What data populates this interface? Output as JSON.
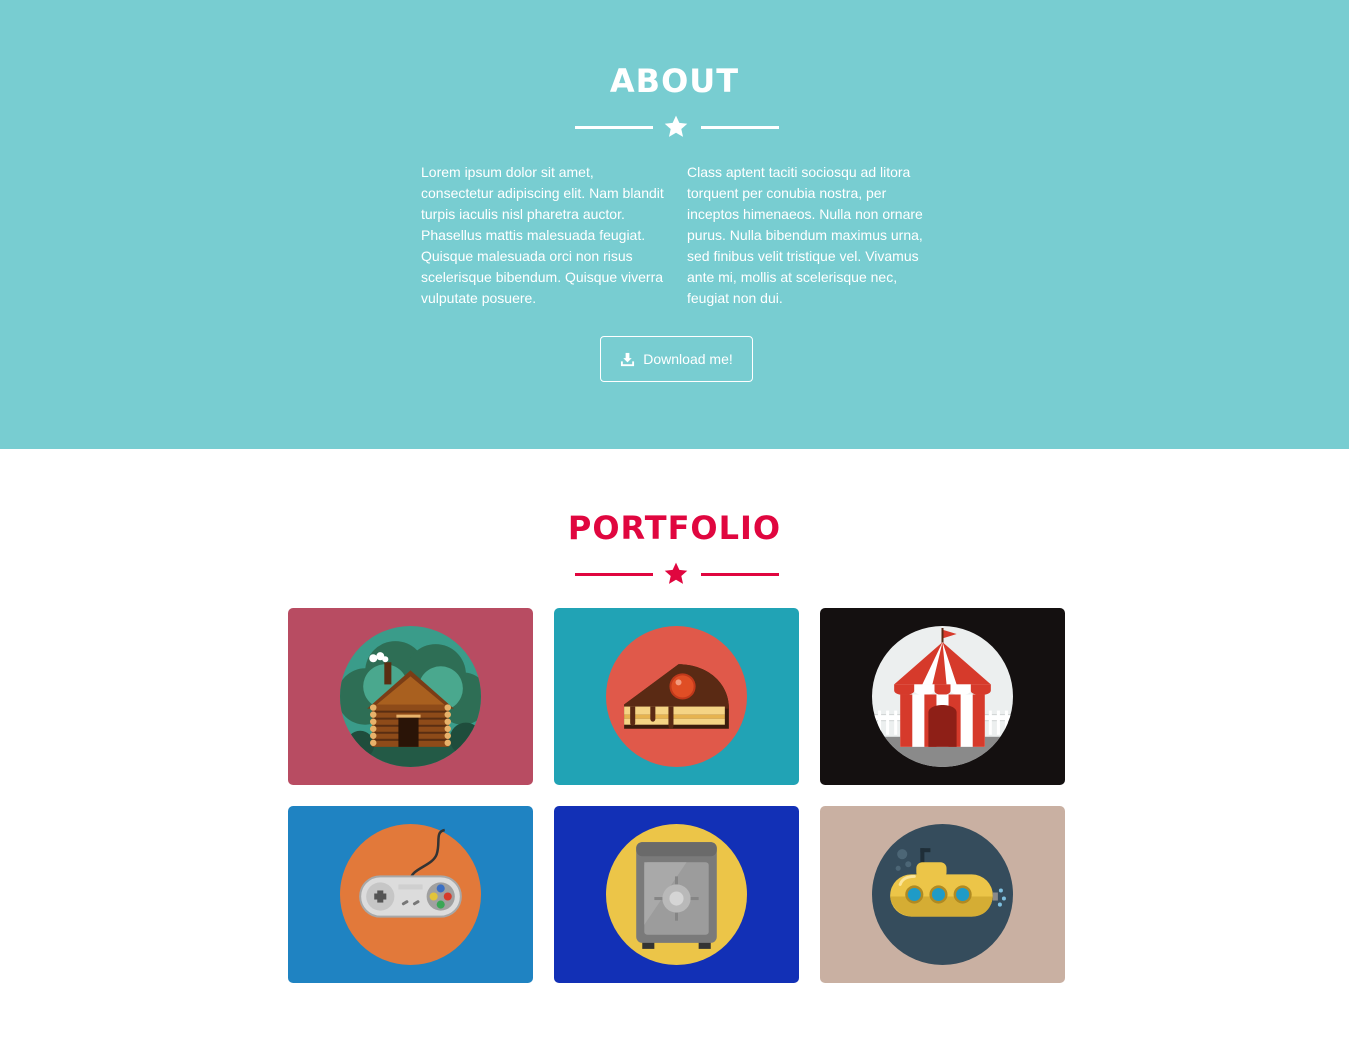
{
  "about": {
    "title": "ABOUT",
    "text_left": "Lorem ipsum dolor sit amet, consectetur adipiscing elit. Nam blandit turpis iaculis nisl pharetra auctor. Phasellus mattis malesuada feugiat. Quisque malesuada orci non risus scelerisque bibendum. Quisque viverra vulputate posuere.",
    "text_right": "Class aptent taciti sociosqu ad litora torquent per conubia nostra, per inceptos himenaeos. Nulla non ornare purus. Nulla bibendum maximus urna, sed finibus velit tristique vel. Vivamus ante mi, mollis at scelerisque nec, feugiat non dui.",
    "download_label": "Download me!",
    "download_icon": "download-icon",
    "background_color": "#78cdd1"
  },
  "portfolio": {
    "title": "PORTFOLIO",
    "accent_color": "#e0063f",
    "items": [
      {
        "name": "cabin",
        "icon": "cabin-icon",
        "background": "#b84c62",
        "circle": "#3a9c8a"
      },
      {
        "name": "cake",
        "icon": "cake-icon",
        "background": "#21a3b5",
        "circle": "#e0594a"
      },
      {
        "name": "circus",
        "icon": "circus-tent-icon",
        "background": "#141010",
        "circle": "#ecefef"
      },
      {
        "name": "game-controller",
        "icon": "game-controller-icon",
        "background": "#1f83c2",
        "circle": "#e2793a"
      },
      {
        "name": "safe",
        "icon": "safe-icon",
        "background": "#1230b6",
        "circle": "#ecc548"
      },
      {
        "name": "submarine",
        "icon": "submarine-icon",
        "background": "#c9b0a2",
        "circle": "#354c5c"
      }
    ]
  }
}
